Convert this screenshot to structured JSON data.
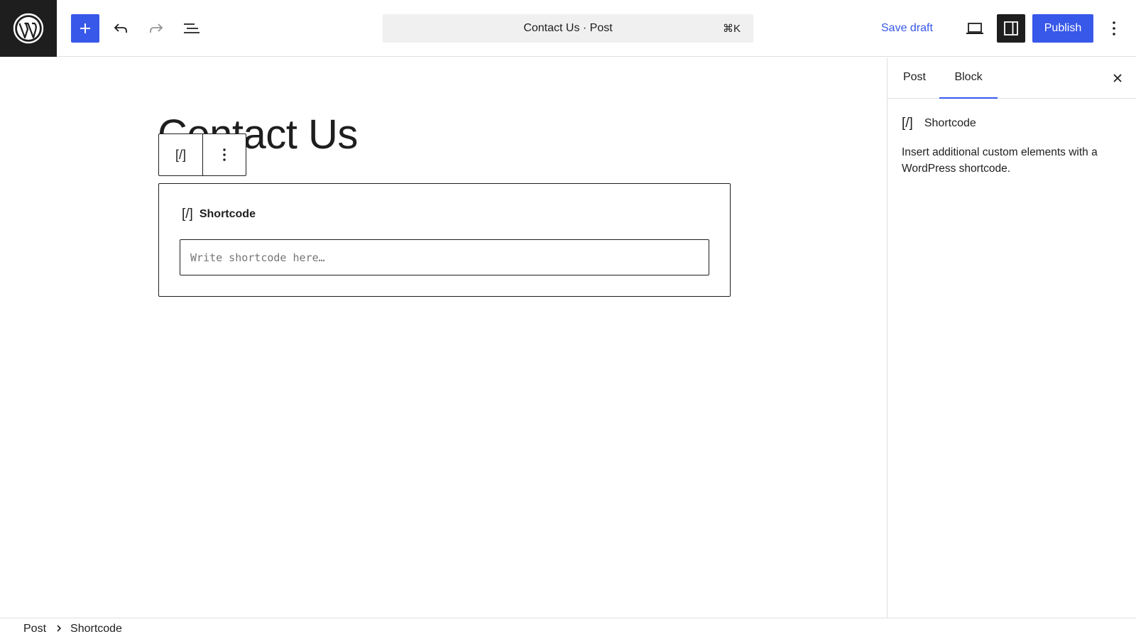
{
  "header": {
    "logo_icon": "wordpress-logo-icon",
    "add_icon": "plus-icon",
    "undo_icon": "undo-icon",
    "redo_icon": "redo-icon",
    "list_view_icon": "list-view-icon",
    "command_bar": {
      "title": "Contact Us · Post",
      "shortcut": "⌘K"
    },
    "save_draft_label": "Save draft",
    "preview_icon": "desktop-preview-icon",
    "settings_icon": "sidebar-toggle-icon",
    "publish_label": "Publish",
    "more_icon": "vertical-dots-icon"
  },
  "editor": {
    "post_title": "Contact Us",
    "block_toolbar": {
      "block_type_glyph": "[/]",
      "options_icon": "vertical-dots-icon"
    },
    "shortcode_block": {
      "glyph": "[/]",
      "label": "Shortcode",
      "input_placeholder": "Write shortcode here…",
      "input_value": ""
    }
  },
  "sidebar": {
    "tabs": [
      {
        "label": "Post",
        "active": false
      },
      {
        "label": "Block",
        "active": true
      }
    ],
    "close_icon": "close-icon",
    "block_card": {
      "glyph": "[/]",
      "title": "Shortcode",
      "description": "Insert additional custom elements with a WordPress shortcode."
    }
  },
  "breadcrumb": {
    "items": [
      "Post",
      "Shortcode"
    ],
    "separator_icon": "chevron-right-icon"
  },
  "colors": {
    "accent": "#3858e9",
    "dark": "#1e1e1e",
    "border": "#e0e0e0",
    "command_bg": "#f0f0f0"
  }
}
